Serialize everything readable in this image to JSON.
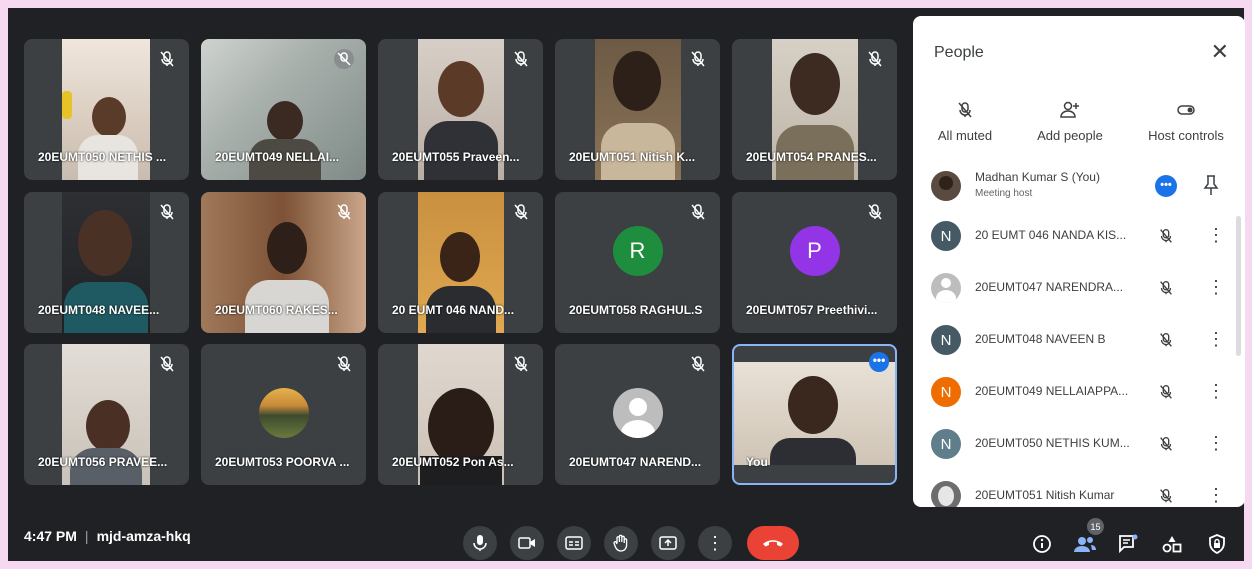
{
  "tiles": [
    {
      "label": "20EUMT050 NETHIS ..."
    },
    {
      "label": "20EUMT049 NELLAI..."
    },
    {
      "label": "20EUMT055 Praveen..."
    },
    {
      "label": "20EUMT051 Nitish K..."
    },
    {
      "label": "20EUMT054 PRANES..."
    },
    {
      "label": "20EUMT048 NAVEE..."
    },
    {
      "label": "20EUMT060 RAKES..."
    },
    {
      "label": "20 EUMT 046 NAND..."
    },
    {
      "label": "20EUMT058 RAGHUL.S",
      "initial": "R"
    },
    {
      "label": "20EUMT057 Preethivi...",
      "initial": "P"
    },
    {
      "label": "20EUMT056 PRAVEE..."
    },
    {
      "label": "20EUMT053 POORVA ..."
    },
    {
      "label": "20EUMT052 Pon As..."
    },
    {
      "label": "20EUMT047 NAREND..."
    },
    {
      "label": "You"
    }
  ],
  "people_panel": {
    "title": "People",
    "controls": {
      "all_muted": "All muted",
      "add_people": "Add people",
      "host_controls": "Host controls"
    },
    "host": {
      "name": "Madhan Kumar S (You)",
      "role": "Meeting host"
    },
    "participants": [
      {
        "initial": "N",
        "name": "20 EUMT 046 NANDA KIS...",
        "color": "#455a64"
      },
      {
        "initial": "",
        "name": "20EUMT047 NARENDRA...",
        "color": "#bdbdbd"
      },
      {
        "initial": "N",
        "name": "20EUMT048 NAVEEN B",
        "color": "#455a64"
      },
      {
        "initial": "N",
        "name": "20EUMT049 NELLAIAPPA...",
        "color": "#ef6c00"
      },
      {
        "initial": "N",
        "name": "20EUMT050 NETHIS KUM...",
        "color": "#607d8b"
      },
      {
        "initial": "",
        "name": "20EUMT051 Nitish Kumar",
        "color": "#6d6d6d"
      }
    ]
  },
  "bottom_bar": {
    "time": "4:47 PM",
    "meeting_code": "mjd-amza-hkq",
    "participant_count": "15"
  },
  "colors": {
    "background": "#202124",
    "tile": "#3c4043",
    "accent_blue": "#8ab4f8",
    "end_call": "#ea4335",
    "avatar_green": "#1e8e3e",
    "avatar_purple": "#9334e6"
  },
  "icons": [
    "mic-off-icon",
    "camera-icon",
    "captions-icon",
    "raise-hand-icon",
    "present-icon",
    "more-vert-icon",
    "end-call-icon",
    "info-icon",
    "people-icon",
    "chat-icon",
    "activities-icon",
    "host-controls-icon",
    "pin-icon",
    "close-icon",
    "add-person-icon"
  ]
}
